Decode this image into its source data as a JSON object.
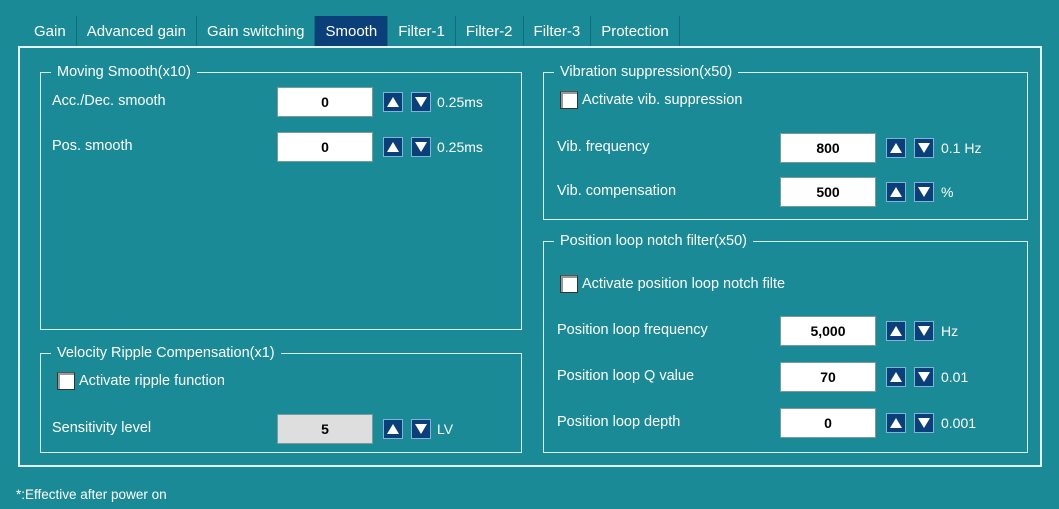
{
  "tabs": [
    {
      "label": "Gain",
      "active": false
    },
    {
      "label": "Advanced gain",
      "active": false
    },
    {
      "label": "Gain switching",
      "active": false
    },
    {
      "label": "Smooth",
      "active": true
    },
    {
      "label": "Filter-1",
      "active": false
    },
    {
      "label": "Filter-2",
      "active": false
    },
    {
      "label": "Filter-3",
      "active": false
    },
    {
      "label": "Protection",
      "active": false
    }
  ],
  "moving_smooth": {
    "title": "Moving Smooth(x10)",
    "acc_dec": {
      "label": "Acc./Dec. smooth",
      "value": "0",
      "unit": "0.25ms"
    },
    "pos": {
      "label": "Pos. smooth",
      "value": "0",
      "unit": "0.25ms"
    }
  },
  "velocity_ripple": {
    "title": "Velocity Ripple Compensation(x1)",
    "activate_label": "Activate ripple function",
    "activate_checked": false,
    "sensitivity": {
      "label": "Sensitivity level",
      "value": "5",
      "unit": "LV"
    }
  },
  "vibration": {
    "title": "Vibration suppression(x50)",
    "activate_label": "Activate vib. suppression",
    "activate_checked": false,
    "frequency": {
      "label": "Vib. frequency",
      "value": "800",
      "unit": "0.1 Hz"
    },
    "compensation": {
      "label": "Vib. compensation",
      "value": "500",
      "unit": "%"
    }
  },
  "notch": {
    "title": "Position loop notch filter(x50)",
    "activate_label": "Activate position loop notch filte",
    "activate_checked": false,
    "frequency": {
      "label": "Position loop frequency",
      "value": "5,000",
      "unit": "Hz"
    },
    "q_value": {
      "label": "Position loop Q value",
      "value": "70",
      "unit": "0.01"
    },
    "depth": {
      "label": "Position loop depth",
      "value": "0",
      "unit": "0.001"
    }
  },
  "footer": {
    "text": "*:Effective after power on"
  },
  "colors": {
    "background": "#1a8a96",
    "active_tab": "#0b3f7a",
    "spin_button": "#0b3f7a"
  }
}
